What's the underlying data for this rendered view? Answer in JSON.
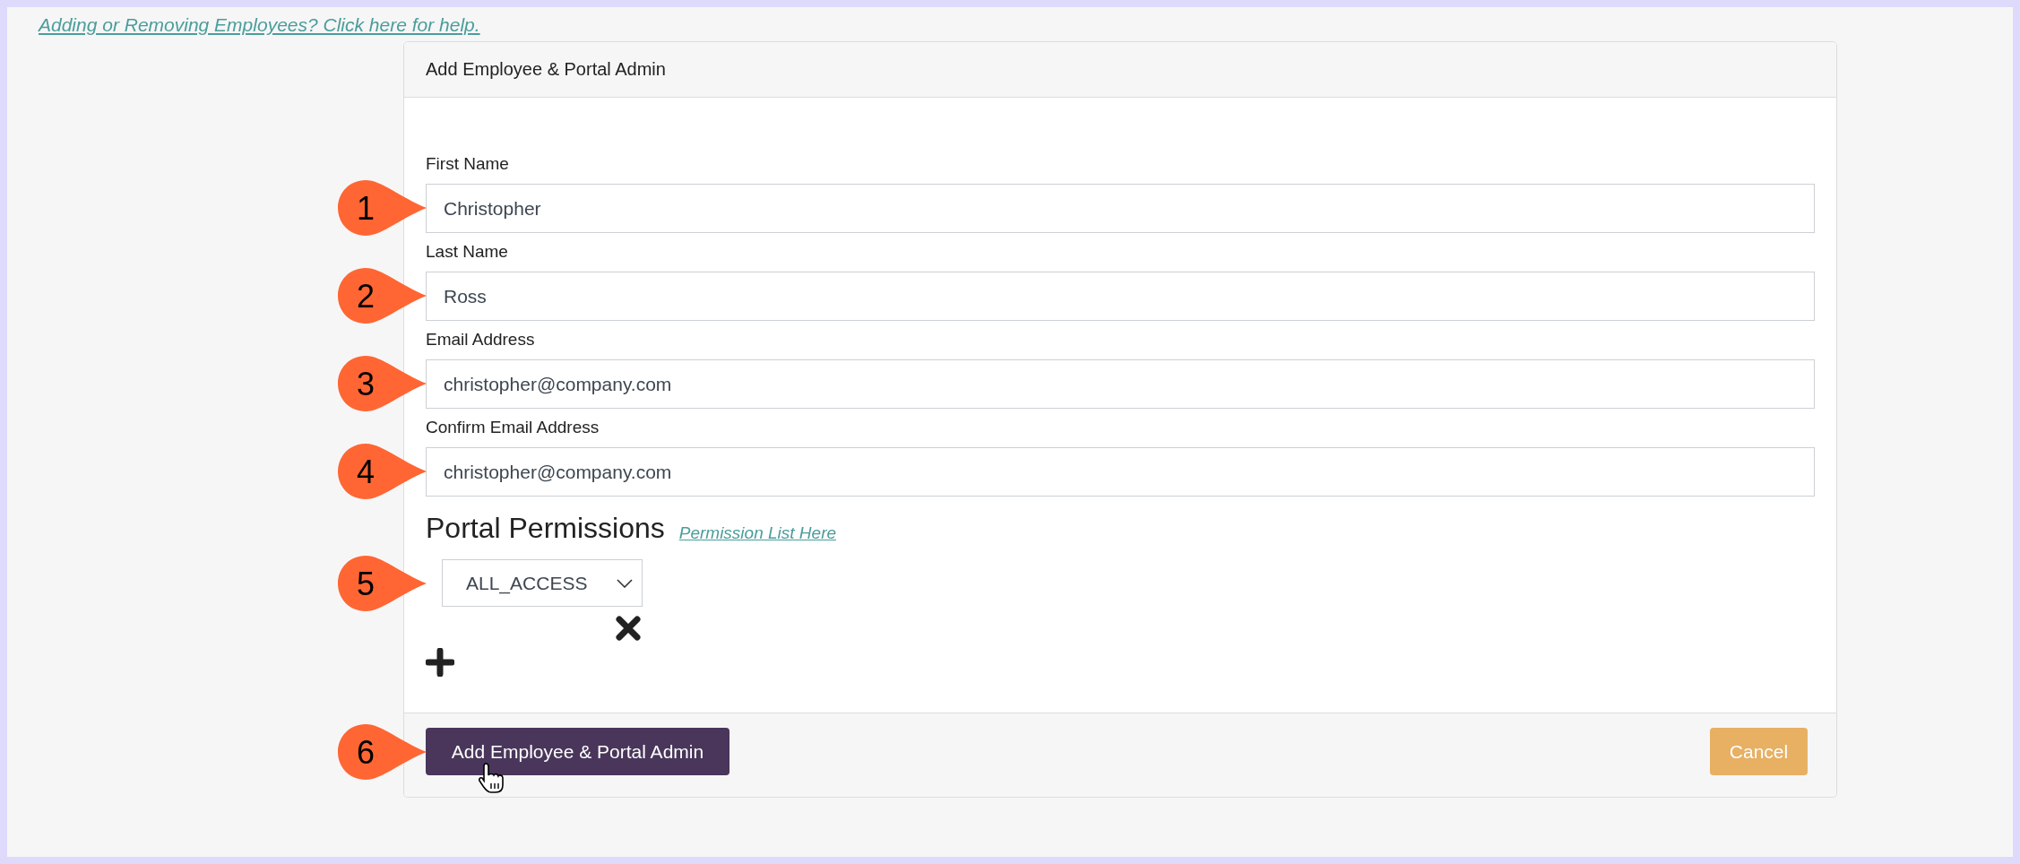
{
  "help_link": "Adding or Removing Employees? Click here for help.",
  "card": {
    "title": "Add Employee & Portal Admin"
  },
  "fields": [
    {
      "label": "First Name",
      "value": "Christopher",
      "marker": "1"
    },
    {
      "label": "Last Name",
      "value": "Ross",
      "marker": "2"
    },
    {
      "label": "Email Address",
      "value": "christopher@company.com",
      "marker": "3"
    },
    {
      "label": "Confirm Email Address",
      "value": "christopher@company.com",
      "marker": "4"
    }
  ],
  "permissions": {
    "heading": "Portal Permissions",
    "link": "Permission List Here",
    "marker": "5",
    "select": {
      "value": "ALL_ACCESS"
    }
  },
  "footer": {
    "submit": {
      "label": "Add Employee & Portal Admin",
      "marker": "6"
    },
    "cancel": {
      "label": "Cancel"
    }
  }
}
